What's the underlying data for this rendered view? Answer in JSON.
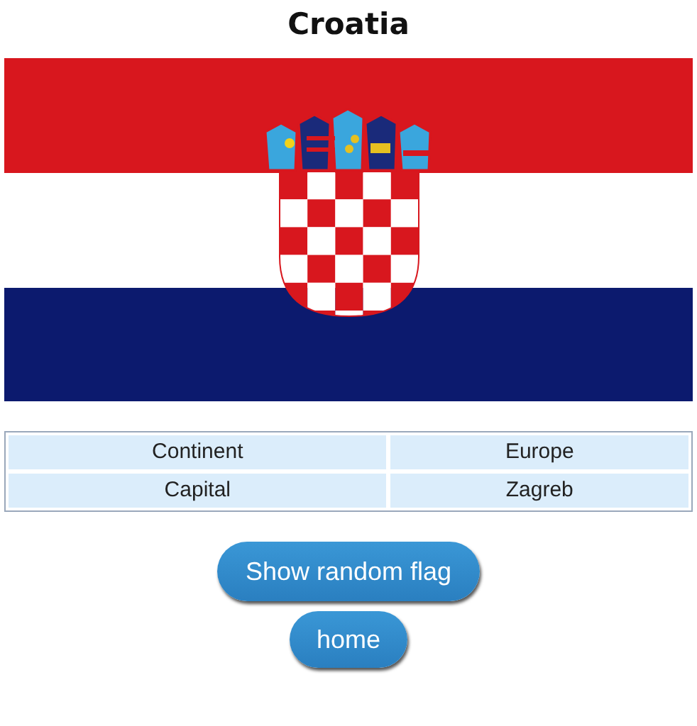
{
  "title": "Croatia",
  "flag": {
    "kind": "flag"
  },
  "facts": [
    {
      "label": "Continent",
      "value": "Europe"
    },
    {
      "label": "Capital",
      "value": "Zagreb"
    }
  ],
  "buttons": [
    "Show random flag",
    "home"
  ]
}
